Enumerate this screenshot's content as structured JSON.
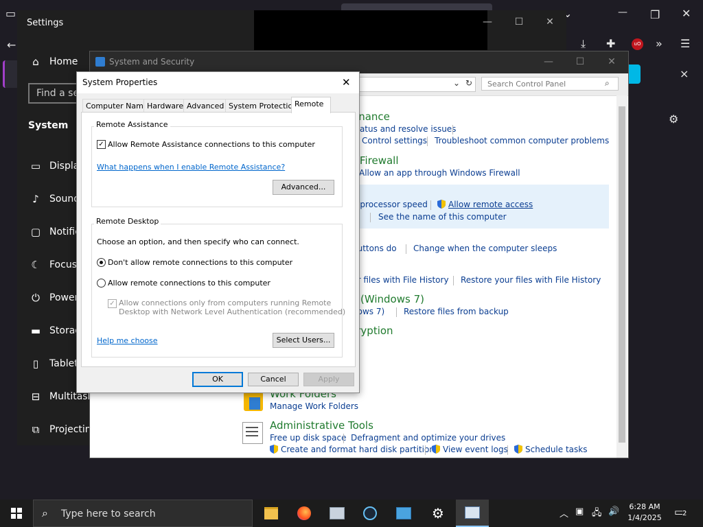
{
  "browser": {
    "tab_close": "×",
    "notification_close": "×"
  },
  "settings": {
    "title": "Settings",
    "home": "Home",
    "search_placeholder": "Find a setting",
    "section": "System",
    "nav": [
      "Display",
      "Sound",
      "Notifications & actions",
      "Focus assist",
      "Power & sleep",
      "Storage",
      "Tablet",
      "Multitasking",
      "Projecting to this PC"
    ]
  },
  "control_panel": {
    "title": "System and Security",
    "search_placeholder": "Search Control Panel",
    "rows": {
      "maintenance_head": "enance",
      "maint_link1": "status and resolve issues",
      "maint_link2": "Control settings",
      "maint_link3": "Troubleshoot common computer problems",
      "firewall_head": "r Firewall",
      "firewall_link1": "Allow an app through Windows Firewall",
      "system_link1": "d processor speed",
      "system_link2": "Allow remote access",
      "system_link3": "e",
      "system_link4": "See the name of this computer",
      "power_link1": "buttons do",
      "power_link2": "Change when the computer sleeps",
      "history_link1": "ur files with File History",
      "history_link2": "Restore your files with File History",
      "backup_head": "e (Windows 7)",
      "backup_link1": "dows 7)",
      "backup_link2": "Restore files from backup",
      "bitlocker_head": "cryption",
      "work_head": "Work Folders",
      "work_link": "Manage Work Folders",
      "admin_head": "Administrative Tools",
      "admin_link1": "Free up disk space",
      "admin_link2": "Defragment and optimize your drives",
      "admin_link3": "Create and format hard disk partitions",
      "admin_link4": "View event logs",
      "admin_link5": "Schedule tasks"
    }
  },
  "dialog": {
    "title": "System Properties",
    "tabs": [
      "Computer Name",
      "Hardware",
      "Advanced",
      "System Protection",
      "Remote"
    ],
    "ra_group": "Remote Assistance",
    "ra_checkbox": "Allow Remote Assistance connections to this computer",
    "ra_link": "What happens when I enable Remote Assistance?",
    "ra_advanced": "Advanced...",
    "rd_group": "Remote Desktop",
    "rd_intro": "Choose an option, and then specify who can connect.",
    "rd_opt1": "Don't allow remote connections to this computer",
    "rd_opt2": "Allow remote connections to this computer",
    "rd_nla_line1": "Allow connections only from computers running Remote",
    "rd_nla_line2": "Desktop with Network Level Authentication (recommended)",
    "rd_help": "Help me choose",
    "rd_select_users": "Select Users...",
    "ok": "OK",
    "cancel": "Cancel",
    "apply": "Apply"
  },
  "taskbar": {
    "search_placeholder": "Type here to search",
    "time": "6:28 AM",
    "date": "1/4/2025",
    "notif_count": "2"
  }
}
